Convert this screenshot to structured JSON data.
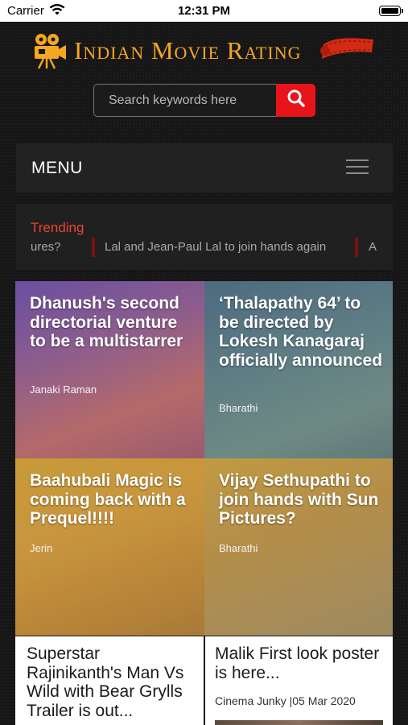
{
  "status_bar": {
    "carrier": "Carrier",
    "time": "12:31 PM"
  },
  "header": {
    "logo_text": "Indian Movie Rating",
    "logo_icon": "film-camera-icon",
    "reel_icon": "film-reel-icon"
  },
  "search": {
    "placeholder": "Search keywords here",
    "value": "",
    "button_icon": "search-icon",
    "accent": "#e8141c"
  },
  "menu": {
    "label": "MENU",
    "icon": "hamburger-icon"
  },
  "trending": {
    "title": "Trending",
    "items": [
      "ures?",
      "Lal and Jean-Paul Lal to join hands again",
      "A"
    ]
  },
  "cards": [
    {
      "title": "Dhanush's second directorial venture to be a multistarrer",
      "author": "Janaki Raman"
    },
    {
      "title": "‘Thalapathy 64’ to be directed by Lokesh Kanagaraj officially announced",
      "author": "Bharathi"
    },
    {
      "title": "Baahubali Magic is coming back with a Prequel!!!!",
      "author": "Jerin"
    },
    {
      "title": "Vijay Sethupathi to join hands with Sun Pictures?",
      "author": "Bharathi"
    }
  ],
  "list_cards": [
    {
      "title": "Superstar Rajinikanth's Man Vs Wild with Bear Grylls Trailer is out...",
      "meta": ""
    },
    {
      "title": "Malik First look poster is here...",
      "meta": "Cinema Junky |05 Mar 2020"
    }
  ],
  "colors": {
    "brand_gold": "#f5a623",
    "trending_red": "#e8452f",
    "background": "#161616"
  }
}
